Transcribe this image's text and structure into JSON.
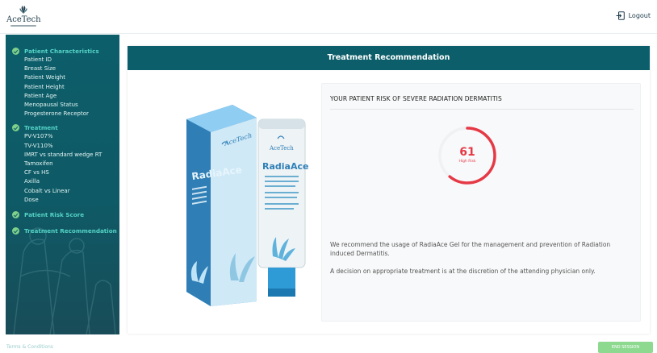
{
  "brand": {
    "name": "AceTech"
  },
  "header": {
    "logout_label": "Logout"
  },
  "sidebar": {
    "groups": [
      {
        "title": "Patient Characteristics",
        "items": [
          "Patient ID",
          "Breast Size",
          "Patient Weight",
          "Patient Height",
          "Patient Age",
          "Menopausal Status",
          "Progesterone Receptor"
        ]
      },
      {
        "title": "Treatment",
        "items": [
          "PV-V107%",
          "TV-V110%",
          "IMRT vs standard wedge RT",
          "Tamoxifen",
          "CF vs HS",
          "Axilla",
          "Cobalt vs Linear",
          "Dose"
        ]
      },
      {
        "title": "Patient Risk Score",
        "items": []
      },
      {
        "title": "Treatment Recommendation",
        "items": []
      }
    ]
  },
  "main": {
    "title": "Treatment Recommendation",
    "product": {
      "box_brand": "AceTech",
      "box_name": "RadiaAce",
      "tube_brand": "AceTech",
      "tube_name": "RadiaAce"
    },
    "risk": {
      "heading": "YOUR PATIENT RISK OF SEVERE RADIATION DERMATITIS",
      "score": "61",
      "score_fraction": 0.61,
      "level": "High Risk",
      "recommendation": "We recommend the usage of RadiaAce Gel for the management and prevention of Radiation induced Dermatitis.",
      "disclaimer": "A decision on appropriate treatment is at the discretion of the attending physician only."
    }
  },
  "footer": {
    "terms_label": "Terms & Conditions",
    "end_session_label": "END SESSION"
  },
  "colors": {
    "primary": "#0c5e6a",
    "accent": "#55d4c7",
    "risk": "#e63946",
    "check": "#7fd08a",
    "end_button": "#8cd98f"
  }
}
